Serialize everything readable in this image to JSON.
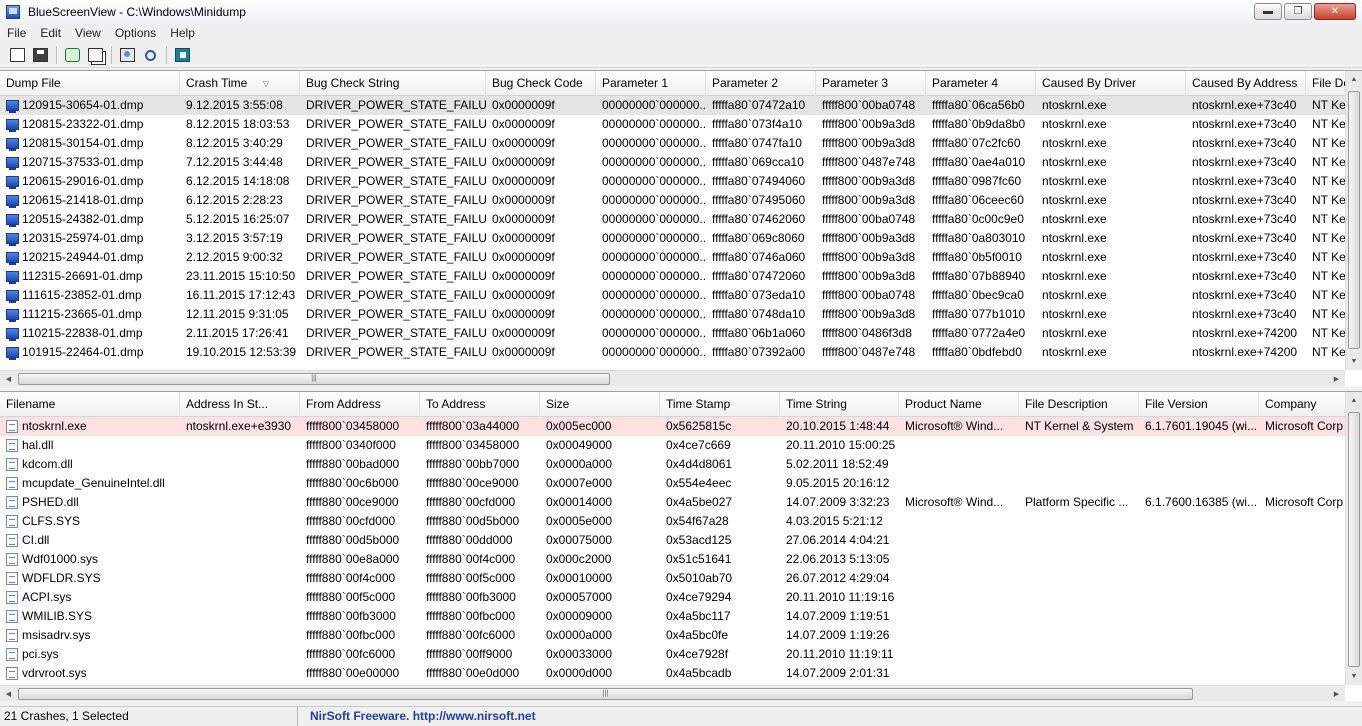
{
  "window": {
    "title": "BlueScreenView  -  C:\\Windows\\Minidump",
    "minimize_glyph": "▬",
    "restore_glyph": "❐",
    "close_glyph": "✕"
  },
  "menu": [
    "File",
    "Edit",
    "View",
    "Options",
    "Help"
  ],
  "toolbar": [
    {
      "name": "html-report-button",
      "icon": "report-icon",
      "cls": "report"
    },
    {
      "name": "save-button",
      "icon": "save-icon",
      "cls": "save"
    },
    {
      "name": "refresh-button",
      "icon": "refresh-icon",
      "cls": "refresh"
    },
    {
      "name": "copy-button",
      "icon": "copy-icon",
      "cls": "copy"
    },
    {
      "name": "properties-button",
      "icon": "properties-icon",
      "cls": "props"
    },
    {
      "name": "find-button",
      "icon": "search-icon",
      "cls": "find"
    },
    {
      "name": "exit-button",
      "icon": "exit-icon",
      "cls": "exit"
    }
  ],
  "crash_list": {
    "sort_indicator": "▽",
    "columns": [
      "Dump File",
      "Crash Time",
      "Bug Check String",
      "Bug Check Code",
      "Parameter 1",
      "Parameter 2",
      "Parameter 3",
      "Parameter 4",
      "Caused By Driver",
      "Caused By Address",
      "File De"
    ],
    "rows": [
      [
        "120915-30654-01.dmp",
        "9.12.2015 3:55:08",
        "DRIVER_POWER_STATE_FAILURE",
        "0x0000009f",
        "00000000`000000...",
        "fffffa80`07472a10",
        "fffff800`00ba0748",
        "fffffa80`06ca56b0",
        "ntoskrnl.exe",
        "ntoskrnl.exe+73c40",
        "NT Ker"
      ],
      [
        "120815-23322-01.dmp",
        "8.12.2015 18:03:53",
        "DRIVER_POWER_STATE_FAILURE",
        "0x0000009f",
        "00000000`000000...",
        "fffffa80`073f4a10",
        "fffff800`00b9a3d8",
        "fffffa80`0b9da8b0",
        "ntoskrnl.exe",
        "ntoskrnl.exe+73c40",
        "NT Ker"
      ],
      [
        "120815-30154-01.dmp",
        "8.12.2015 3:40:29",
        "DRIVER_POWER_STATE_FAILURE",
        "0x0000009f",
        "00000000`000000...",
        "fffffa80`0747fa10",
        "fffff800`00b9a3d8",
        "fffffa80`07c2fc60",
        "ntoskrnl.exe",
        "ntoskrnl.exe+73c40",
        "NT Ker"
      ],
      [
        "120715-37533-01.dmp",
        "7.12.2015 3:44:48",
        "DRIVER_POWER_STATE_FAILURE",
        "0x0000009f",
        "00000000`000000...",
        "fffffa80`069cca10",
        "fffff800`0487e748",
        "fffffa80`0ae4a010",
        "ntoskrnl.exe",
        "ntoskrnl.exe+73c40",
        "NT Ker"
      ],
      [
        "120615-29016-01.dmp",
        "6.12.2015 14:18:08",
        "DRIVER_POWER_STATE_FAILURE",
        "0x0000009f",
        "00000000`000000...",
        "fffffa80`07494060",
        "fffff800`00b9a3d8",
        "fffffa80`0987fc60",
        "ntoskrnl.exe",
        "ntoskrnl.exe+73c40",
        "NT Ker"
      ],
      [
        "120615-21418-01.dmp",
        "6.12.2015 2:28:23",
        "DRIVER_POWER_STATE_FAILURE",
        "0x0000009f",
        "00000000`000000...",
        "fffffa80`07495060",
        "fffff800`00b9a3d8",
        "fffffa80`06ceec60",
        "ntoskrnl.exe",
        "ntoskrnl.exe+73c40",
        "NT Ker"
      ],
      [
        "120515-24382-01.dmp",
        "5.12.2015 16:25:07",
        "DRIVER_POWER_STATE_FAILURE",
        "0x0000009f",
        "00000000`000000...",
        "fffffa80`07462060",
        "fffff800`00ba0748",
        "fffffa80`0c00c9e0",
        "ntoskrnl.exe",
        "ntoskrnl.exe+73c40",
        "NT Ker"
      ],
      [
        "120315-25974-01.dmp",
        "3.12.2015 3:57:19",
        "DRIVER_POWER_STATE_FAILURE",
        "0x0000009f",
        "00000000`000000...",
        "fffffa80`069c8060",
        "fffff800`00b9a3d8",
        "fffffa80`0a803010",
        "ntoskrnl.exe",
        "ntoskrnl.exe+73c40",
        "NT Ker"
      ],
      [
        "120215-24944-01.dmp",
        "2.12.2015 9:00:32",
        "DRIVER_POWER_STATE_FAILURE",
        "0x0000009f",
        "00000000`000000...",
        "fffffa80`0746a060",
        "fffff800`00b9a3d8",
        "fffffa80`0b5f0010",
        "ntoskrnl.exe",
        "ntoskrnl.exe+73c40",
        "NT Ker"
      ],
      [
        "112315-26691-01.dmp",
        "23.11.2015 15:10:50",
        "DRIVER_POWER_STATE_FAILURE",
        "0x0000009f",
        "00000000`000000...",
        "fffffa80`07472060",
        "fffff800`00b9a3d8",
        "fffffa80`07b88940",
        "ntoskrnl.exe",
        "ntoskrnl.exe+73c40",
        "NT Ker"
      ],
      [
        "111615-23852-01.dmp",
        "16.11.2015 17:12:43",
        "DRIVER_POWER_STATE_FAILURE",
        "0x0000009f",
        "00000000`000000...",
        "fffffa80`073eda10",
        "fffff800`00ba0748",
        "fffffa80`0bec9ca0",
        "ntoskrnl.exe",
        "ntoskrnl.exe+73c40",
        "NT Ker"
      ],
      [
        "111215-23665-01.dmp",
        "12.11.2015 9:31:05",
        "DRIVER_POWER_STATE_FAILURE",
        "0x0000009f",
        "00000000`000000...",
        "fffffa80`0748da10",
        "fffff800`00b9a3d8",
        "fffffa80`077b1010",
        "ntoskrnl.exe",
        "ntoskrnl.exe+73c40",
        "NT Ker"
      ],
      [
        "110215-22838-01.dmp",
        "2.11.2015 17:26:41",
        "DRIVER_POWER_STATE_FAILURE",
        "0x0000009f",
        "00000000`000000...",
        "fffffa80`06b1a060",
        "fffff800`0486f3d8",
        "fffffa80`0772a4e0",
        "ntoskrnl.exe",
        "ntoskrnl.exe+74200",
        "NT Ker"
      ],
      [
        "101915-22464-01.dmp",
        "19.10.2015 12:53:39",
        "DRIVER_POWER_STATE_FAILURE",
        "0x0000009f",
        "00000000`000000...",
        "fffffa80`07392a00",
        "fffff800`0487e748",
        "fffffa80`0bdfebd0",
        "ntoskrnl.exe",
        "ntoskrnl.exe+74200",
        "NT Ker"
      ]
    ]
  },
  "driver_list": {
    "columns": [
      "Filename",
      "Address In St...",
      "From Address",
      "To Address",
      "Size",
      "Time Stamp",
      "Time String",
      "Product Name",
      "File Description",
      "File Version",
      "Company"
    ],
    "rows": [
      [
        "ntoskrnl.exe",
        "ntoskrnl.exe+e3930",
        "fffff800`03458000",
        "fffff800`03a44000",
        "0x005ec000",
        "0x5625815c",
        "20.10.2015 1:48:44",
        "Microsoft® Wind...",
        "NT Kernel & System",
        "6.1.7601.19045 (wi...",
        "Microsoft Corp"
      ],
      [
        "hal.dll",
        "",
        "fffff800`0340f000",
        "fffff800`03458000",
        "0x00049000",
        "0x4ce7c669",
        "20.11.2010 15:00:25",
        "",
        "",
        "",
        ""
      ],
      [
        "kdcom.dll",
        "",
        "fffff880`00bad000",
        "fffff880`00bb7000",
        "0x0000a000",
        "0x4d4d8061",
        "5.02.2011 18:52:49",
        "",
        "",
        "",
        ""
      ],
      [
        "mcupdate_GenuineIntel.dll",
        "",
        "fffff880`00c6b000",
        "fffff880`00ce9000",
        "0x0007e000",
        "0x554e4eec",
        "9.05.2015 20:16:12",
        "",
        "",
        "",
        ""
      ],
      [
        "PSHED.dll",
        "",
        "fffff880`00ce9000",
        "fffff880`00cfd000",
        "0x00014000",
        "0x4a5be027",
        "14.07.2009 3:32:23",
        "Microsoft® Wind...",
        "Platform Specific ...",
        "6.1.7600.16385 (wi...",
        "Microsoft Corp"
      ],
      [
        "CLFS.SYS",
        "",
        "fffff880`00cfd000",
        "fffff880`00d5b000",
        "0x0005e000",
        "0x54f67a28",
        "4.03.2015 5:21:12",
        "",
        "",
        "",
        ""
      ],
      [
        "CI.dll",
        "",
        "fffff880`00d5b000",
        "fffff880`00dd000",
        "0x00075000",
        "0x53acd125",
        "27.06.2014 4:04:21",
        "",
        "",
        "",
        ""
      ],
      [
        "Wdf01000.sys",
        "",
        "fffff880`00e8a000",
        "fffff880`00f4c000",
        "0x000c2000",
        "0x51c51641",
        "22.06.2013 5:13:05",
        "",
        "",
        "",
        ""
      ],
      [
        "WDFLDR.SYS",
        "",
        "fffff880`00f4c000",
        "fffff880`00f5c000",
        "0x00010000",
        "0x5010ab70",
        "26.07.2012 4:29:04",
        "",
        "",
        "",
        ""
      ],
      [
        "ACPI.sys",
        "",
        "fffff880`00f5c000",
        "fffff880`00fb3000",
        "0x00057000",
        "0x4ce79294",
        "20.11.2010 11:19:16",
        "",
        "",
        "",
        ""
      ],
      [
        "WMILIB.SYS",
        "",
        "fffff880`00fb3000",
        "fffff880`00fbc000",
        "0x00009000",
        "0x4a5bc117",
        "14.07.2009 1:19:51",
        "",
        "",
        "",
        ""
      ],
      [
        "msisadrv.sys",
        "",
        "fffff880`00fbc000",
        "fffff880`00fc6000",
        "0x0000a000",
        "0x4a5bc0fe",
        "14.07.2009 1:19:26",
        "",
        "",
        "",
        ""
      ],
      [
        "pci.sys",
        "",
        "fffff880`00fc6000",
        "fffff880`00ff9000",
        "0x00033000",
        "0x4ce7928f",
        "20.11.2010 11:19:11",
        "",
        "",
        "",
        ""
      ],
      [
        "vdrvroot.sys",
        "",
        "fffff880`00e00000",
        "fffff880`00e0d000",
        "0x0000d000",
        "0x4a5bcadb",
        "14.07.2009 2:01:31",
        "",
        "",
        "",
        ""
      ]
    ]
  },
  "scrollbars": {
    "up": "▲",
    "down": "▼",
    "left": "◀",
    "right": "▶",
    "grip": "|||"
  },
  "status": {
    "summary": "21 Crashes, 1 Selected",
    "link": "NirSoft Freeware.  http://www.nirsoft.net"
  },
  "colors": {
    "selected_top": "#e4e4e4",
    "selected_bottom": "#fde1e3",
    "link": "#1f3da8"
  }
}
